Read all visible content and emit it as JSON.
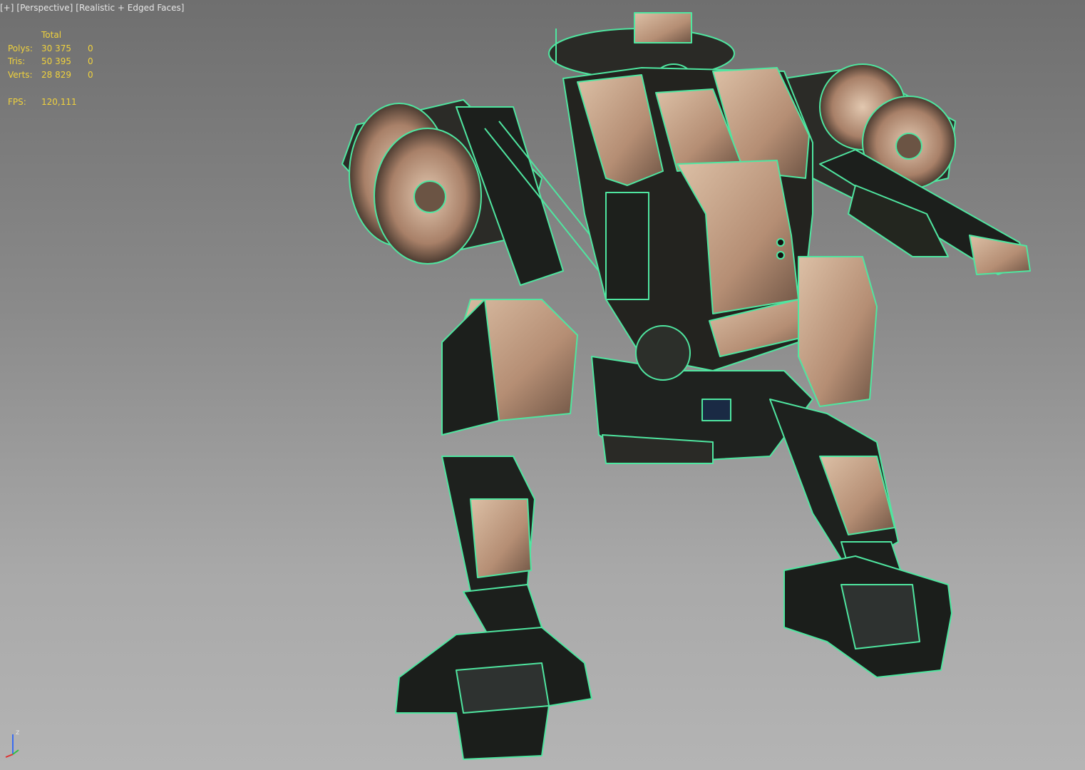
{
  "viewport": {
    "labels": [
      "[+]",
      "[Perspective]",
      "[Realistic + Edged Faces]"
    ]
  },
  "stats": {
    "header": "Total",
    "rows": [
      {
        "label": "Polys:",
        "total": "30 375",
        "selected": "0"
      },
      {
        "label": "Tris:",
        "total": "50 395",
        "selected": "0"
      },
      {
        "label": "Verts:",
        "total": "28 829",
        "selected": "0"
      }
    ],
    "fps_label": "FPS:",
    "fps_value": "120,111"
  },
  "axis": {
    "z": "z"
  },
  "colors": {
    "stats_text": "#f0d23c",
    "wire": "#4fe6a0",
    "metal_light": "#c9a78c",
    "metal_dark": "#1c1f1c"
  }
}
